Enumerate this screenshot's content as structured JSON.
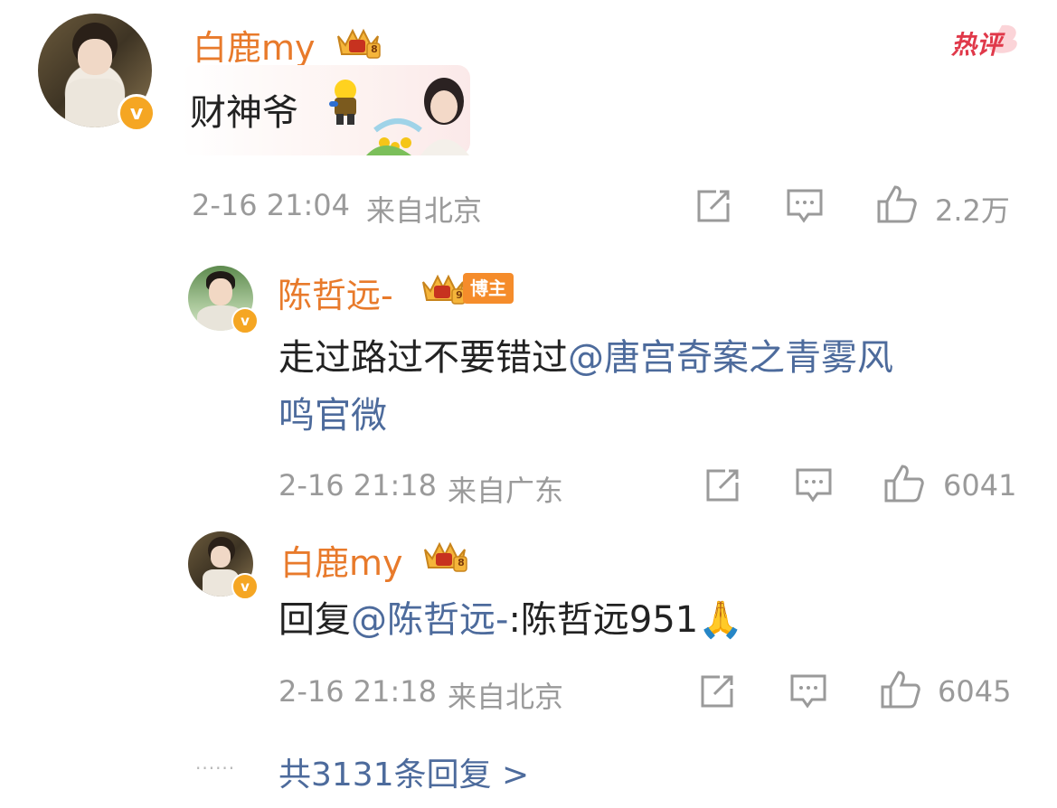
{
  "badge": {
    "hot": "热评"
  },
  "comment": {
    "author": "白鹿my",
    "text": "财神爷",
    "time": "2-16 21:04",
    "location": "来自北京",
    "likes": "2.2万",
    "level": "8"
  },
  "replies": [
    {
      "author": "陈哲远-",
      "tag": "博主",
      "level": "9",
      "text_line1": "走过路过不要错过",
      "mention_line1": "@唐宫奇案之青雾风",
      "mention_line2": "鸣官微",
      "time": "2-16 21:18",
      "location": "来自广东",
      "likes": "6041"
    },
    {
      "author": "白鹿my",
      "level": "8",
      "prefix": "回复",
      "mention": "@陈哲远-",
      "text": ":陈哲远951",
      "emoji": "🙏",
      "time": "2-16 21:18",
      "location": "来自北京",
      "likes": "6045"
    }
  ],
  "more": {
    "dots": "······",
    "label": "共3131条回复 >"
  },
  "colors": {
    "name": "#e87a2b",
    "mention": "#4d6b9c",
    "meta": "#9a9a9a",
    "hot": "#e0394a"
  }
}
